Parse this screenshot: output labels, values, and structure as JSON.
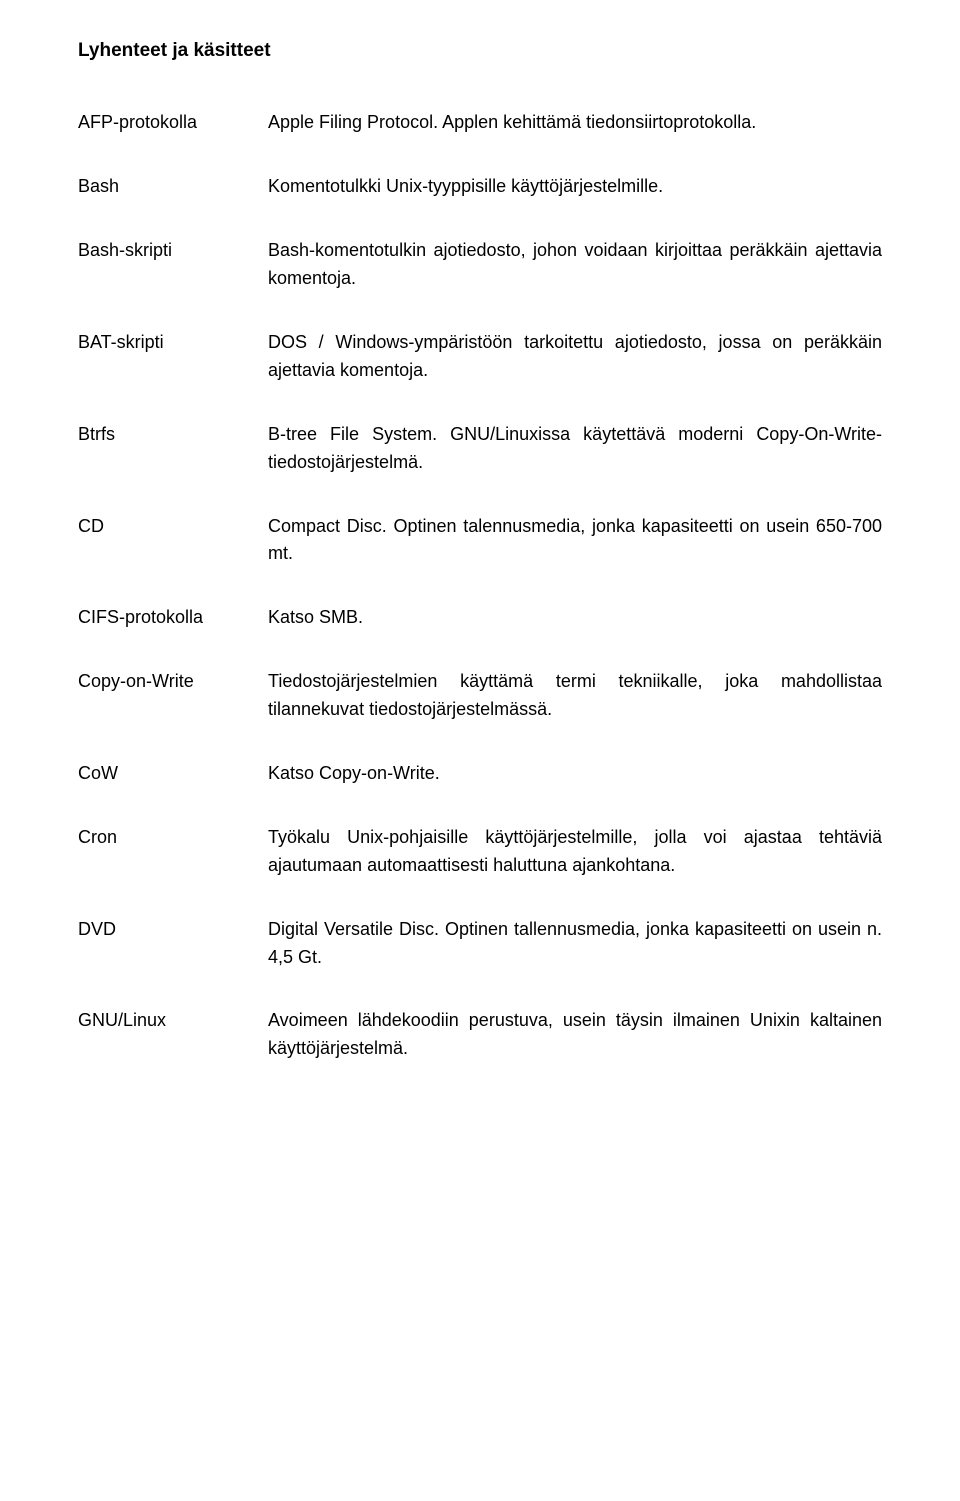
{
  "title": "Lyhenteet ja käsitteet",
  "entries": [
    {
      "term": "AFP-protokolla",
      "definition": "Apple Filing Protocol. Applen kehittämä tiedonsiirtoprotokolla."
    },
    {
      "term": "Bash",
      "definition": "Komentotulkki Unix-tyyppisille käyttöjärjestelmille."
    },
    {
      "term": "Bash-skripti",
      "definition": "Bash-komentotulkin ajotiedosto, johon voidaan kirjoittaa peräkkäin ajettavia komentoja."
    },
    {
      "term": "BAT-skripti",
      "definition": "DOS / Windows-ympäristöön tarkoitettu ajotiedosto, jossa on peräkkäin ajettavia komentoja."
    },
    {
      "term": "Btrfs",
      "definition": "B-tree File System. GNU/Linuxissa käytettävä moderni Copy-On-Write-tiedostojärjestelmä."
    },
    {
      "term": "CD",
      "definition": "Compact Disc. Optinen talennusmedia, jonka kapasiteetti on usein 650-700 mt."
    },
    {
      "term": "CIFS-protokolla",
      "definition": "Katso SMB."
    },
    {
      "term": "Copy-on-Write",
      "definition": "Tiedostojärjestelmien käyttämä termi tekniikalle, joka mahdollistaa tilannekuvat tiedostojärjestelmässä."
    },
    {
      "term": "CoW",
      "definition": "Katso Copy-on-Write."
    },
    {
      "term": "Cron",
      "definition": "Työkalu Unix-pohjaisille käyttöjärjestelmille, jolla voi ajastaa tehtäviä ajautumaan automaattisesti haluttuna ajankohtana."
    },
    {
      "term": "DVD",
      "definition": "Digital Versatile Disc. Optinen tallennusmedia, jonka kapasiteetti on usein n. 4,5 Gt."
    },
    {
      "term": "GNU/Linux",
      "definition": "Avoimeen lähdekoodiin perustuva, usein täysin ilmainen Unixin kaltainen käyttöjärjestelmä."
    }
  ]
}
